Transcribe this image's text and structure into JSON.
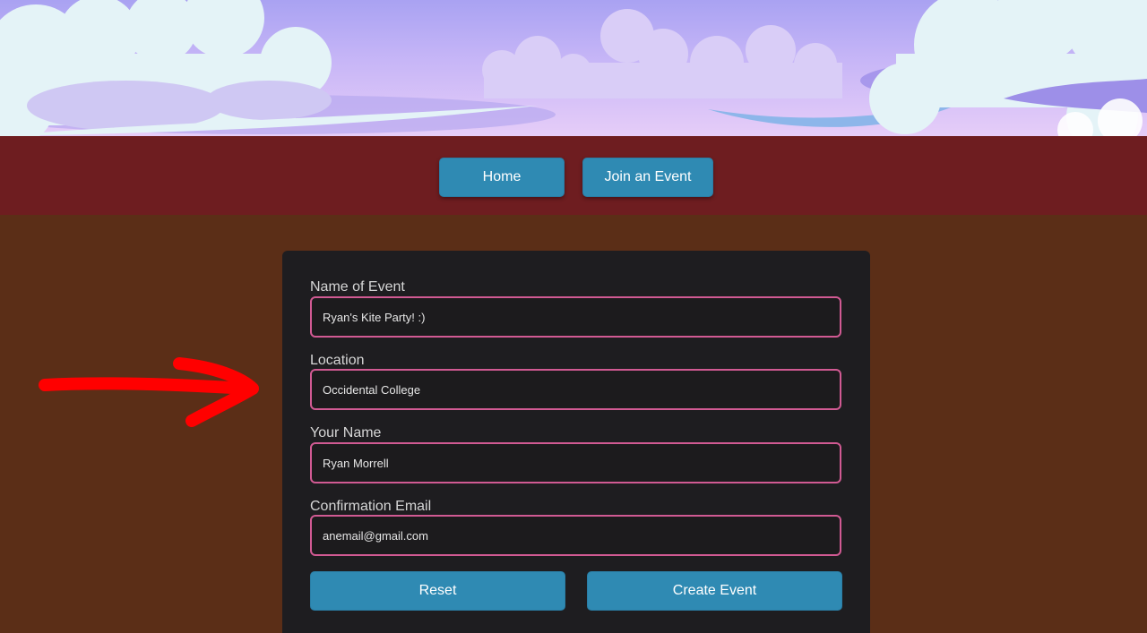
{
  "nav": {
    "home_label": "Home",
    "join_label": "Join an Event"
  },
  "form": {
    "name_of_event": {
      "label": "Name of Event",
      "value": "Ryan's Kite Party! :)"
    },
    "location": {
      "label": "Location",
      "value": "Occidental College"
    },
    "your_name": {
      "label": "Your Name",
      "value": "Ryan Morrell"
    },
    "confirmation_email": {
      "label": "Confirmation Email",
      "value": "anemail@gmail.com"
    },
    "reset_label": "Reset",
    "create_label": "Create Event"
  },
  "icons": {
    "annotation": "red-arrow-icon"
  },
  "colors": {
    "nav_bar": "#6e1d20",
    "page_background": "#5b2e17",
    "button": "#2f8ab3",
    "card": "#1e1d20",
    "input_border": "#d15a93",
    "annotation_arrow": "#ff0000"
  }
}
